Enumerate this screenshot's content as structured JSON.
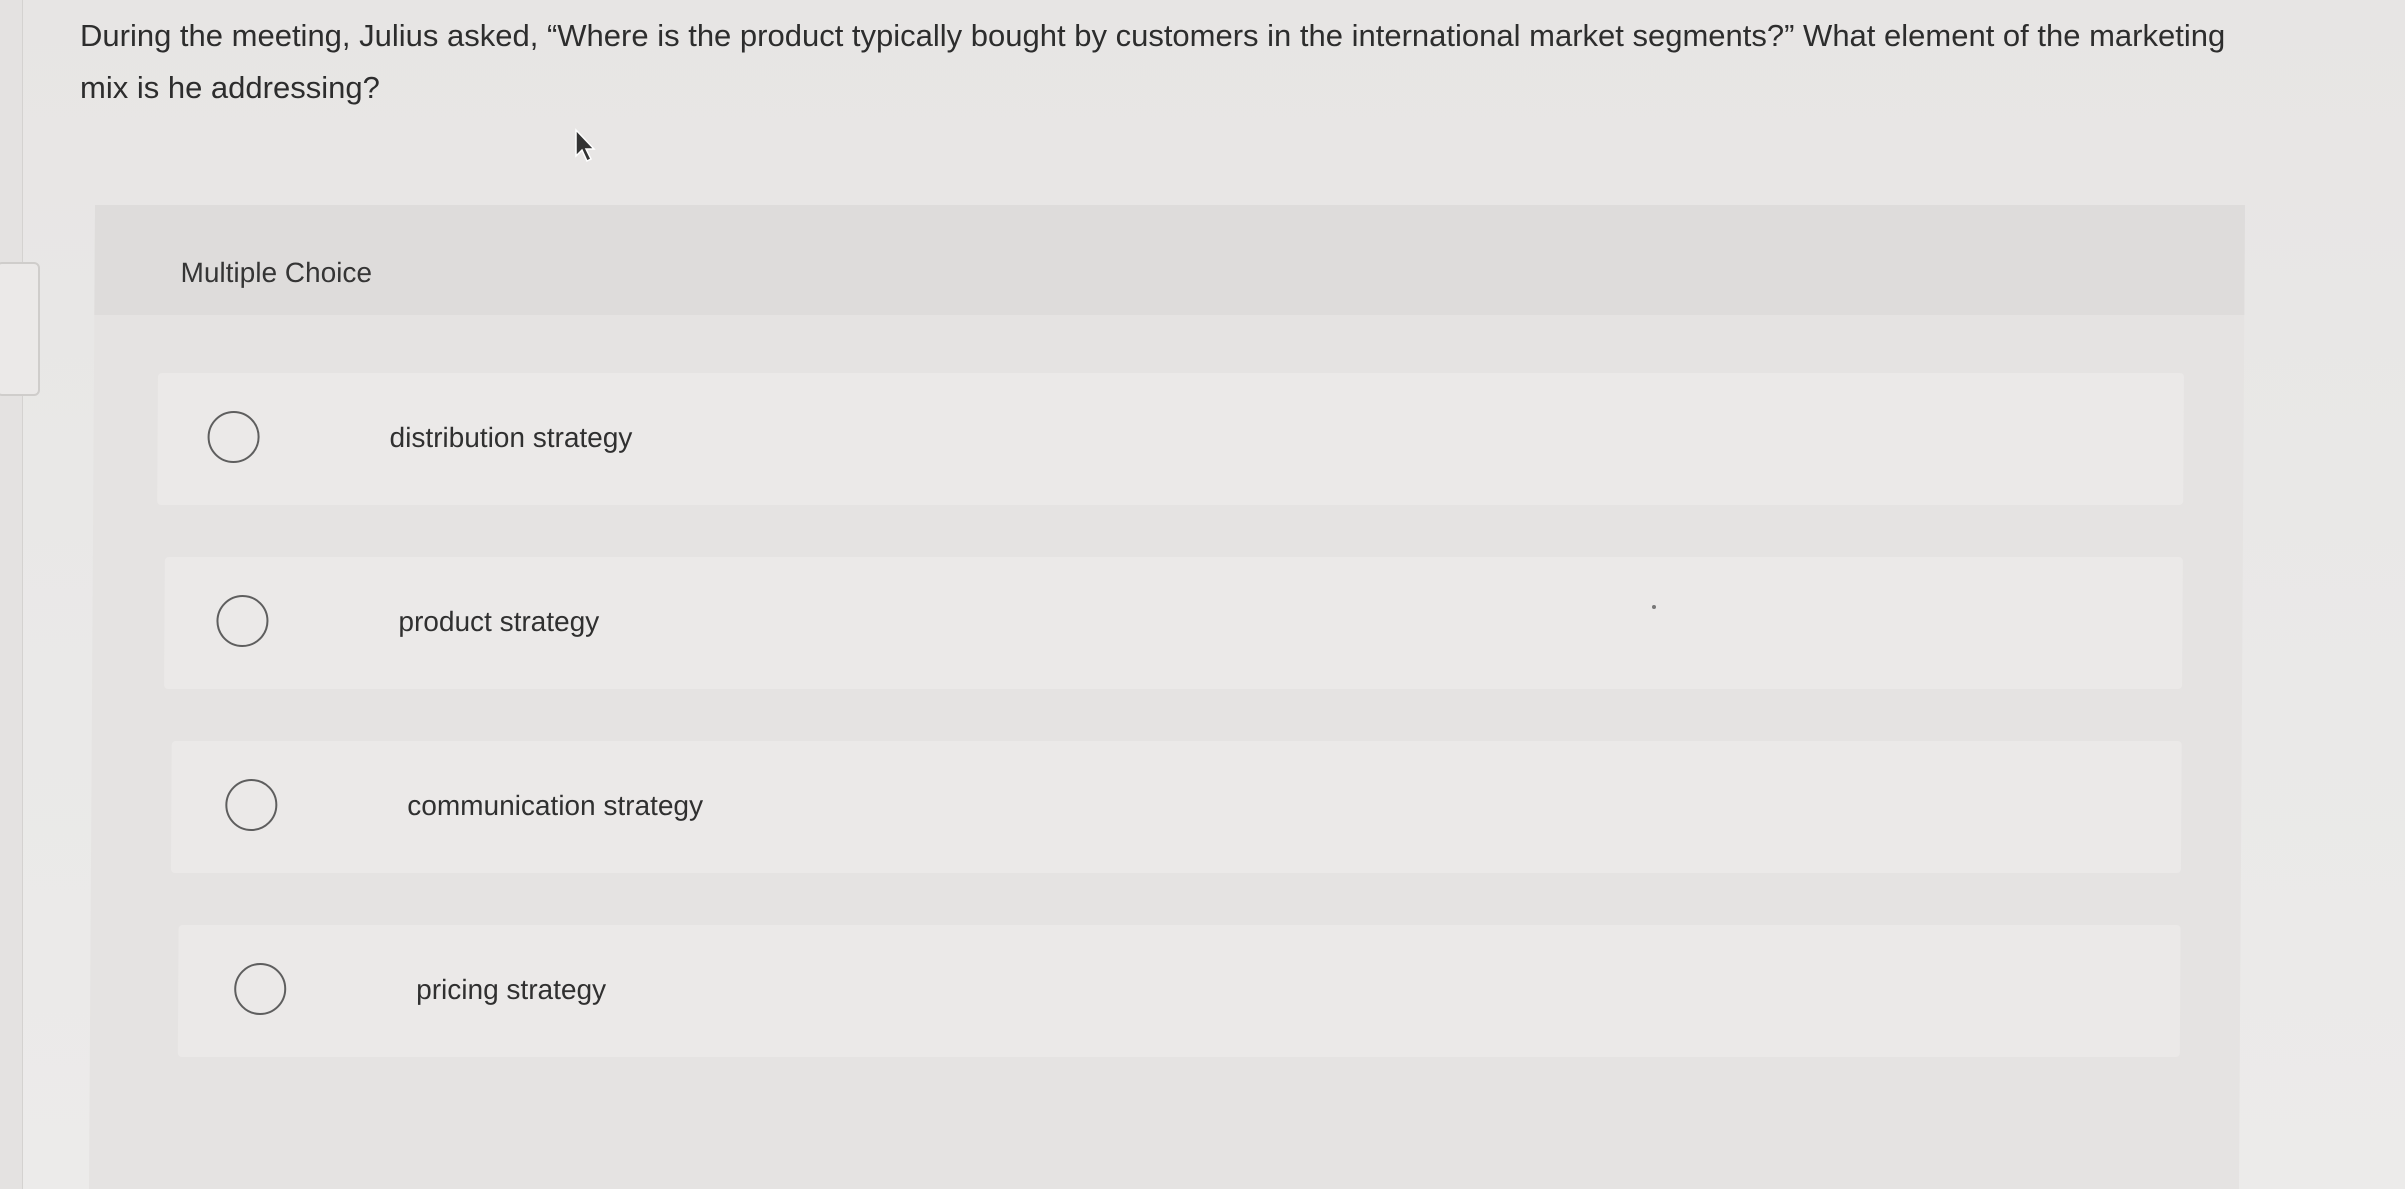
{
  "question": {
    "text": "During the meeting, Julius asked, “Where is the product typically bought by customers in the international market segments?” What element of the marketing mix is he addressing?"
  },
  "panel": {
    "title": "Multiple Choice"
  },
  "options": [
    {
      "label": "distribution strategy",
      "selected": false
    },
    {
      "label": "product strategy",
      "selected": false
    },
    {
      "label": "communication strategy",
      "selected": false
    },
    {
      "label": "pricing strategy",
      "selected": false
    }
  ],
  "icons": {
    "cursor": "mouse-pointer-icon",
    "radio": "radio-button-icon"
  },
  "colors": {
    "background": "#e9e8e7",
    "panel": "#e5e3e2",
    "option": "#ebe9e8",
    "text": "#2d2d2d",
    "radio_border": "#5e5e5e"
  }
}
